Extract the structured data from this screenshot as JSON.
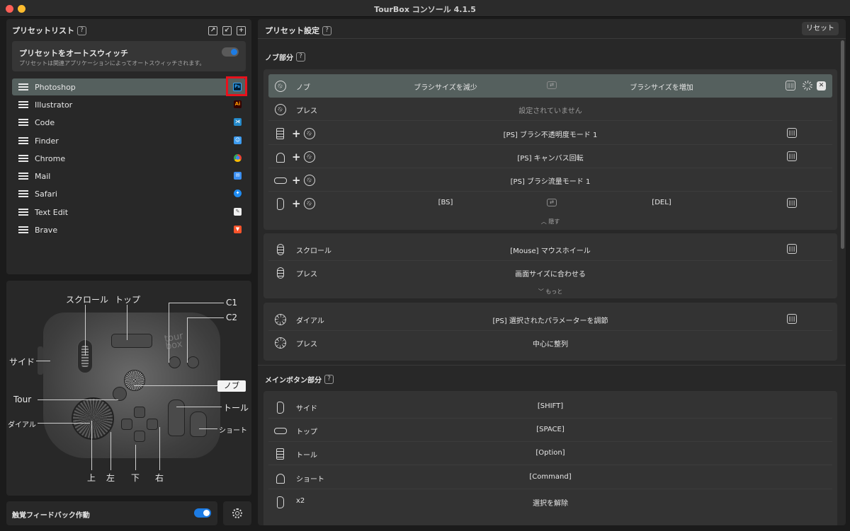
{
  "window": {
    "title": "TourBox コンソール 4.1.5"
  },
  "left": {
    "preset_list_title": "プリセットリスト",
    "help": "?",
    "auto_switch": {
      "title": "プリセットをオートスウィッチ",
      "subtitle": "プリセットは関連アプリケーションによってオートスウィッチされます。",
      "on": true
    },
    "presets": [
      {
        "name": "Photoshop",
        "icon": "Ps",
        "color": "#31a8ff",
        "bg": "#001e36",
        "active": true
      },
      {
        "name": "Illustrator",
        "icon": "Ai",
        "color": "#ff9a00",
        "bg": "#330000"
      },
      {
        "name": "Code",
        "icon": "⋊",
        "color": "#ffffff",
        "bg": "#2489ca"
      },
      {
        "name": "Finder",
        "icon": "☺",
        "color": "#ffffff",
        "bg": "#3d9cf0"
      },
      {
        "name": "Chrome",
        "icon": "●",
        "color": "#fbbc05",
        "bg": "#ea4335"
      },
      {
        "name": "Mail",
        "icon": "✉",
        "color": "#ffffff",
        "bg": "#3b8ff2"
      },
      {
        "name": "Safari",
        "icon": "✦",
        "color": "#ffffff",
        "bg": "#1f8cf3"
      },
      {
        "name": "Text Edit",
        "icon": "✎",
        "color": "#555555",
        "bg": "#f0f0f0"
      },
      {
        "name": "Brave",
        "icon": "▼",
        "color": "#ffffff",
        "bg": "#fb542b"
      }
    ],
    "device_labels": {
      "scroll": "スクロール",
      "top": "トップ",
      "c1": "C1",
      "c2": "C2",
      "side": "サイド",
      "tour": "Tour",
      "knob": "ノブ",
      "tall": "トール",
      "dial": "ダイアル",
      "short": "ショート",
      "up": "上",
      "left": "左",
      "down": "下",
      "right": "右"
    },
    "haptic": {
      "label": "触覚フィードバック作動",
      "on": true
    }
  },
  "right": {
    "preset_settings": "プリセット設定",
    "reset": "リセット",
    "knob_section": "ノブ部分",
    "hide": "隠す",
    "more": "もっと",
    "main_button_section": "メインボタン部分",
    "knob_rows": [
      {
        "name": "ノブ",
        "left": "ブラシサイズを減少",
        "right": "ブラシサイズを増加"
      },
      {
        "name": "プレス",
        "center": "設定されていません"
      },
      {
        "center": "[PS] ブラシ不透明度モード 1"
      },
      {
        "center": "[PS] キャンバス回転"
      },
      {
        "center": "[PS] ブラシ流量モード 1"
      },
      {
        "left": "[BS]",
        "right": "[DEL]"
      }
    ],
    "scroll_rows": [
      {
        "name": "スクロール",
        "center": "[Mouse] マウスホイール"
      },
      {
        "name": "プレス",
        "center": "画面サイズに合わせる"
      }
    ],
    "dial_rows": [
      {
        "name": "ダイアル",
        "center": "[PS] 選択されたパラメーターを調節"
      },
      {
        "name": "プレス",
        "center": "中心に整列"
      }
    ],
    "main_rows": [
      {
        "name": "サイド",
        "center": "[SHIFT]"
      },
      {
        "name": "トップ",
        "center": "[SPACE]"
      },
      {
        "name": "トール",
        "center": "[Option]"
      },
      {
        "name": "ショート",
        "center": "[Command]"
      },
      {
        "name": "x2",
        "center": "選択を解除"
      }
    ]
  }
}
